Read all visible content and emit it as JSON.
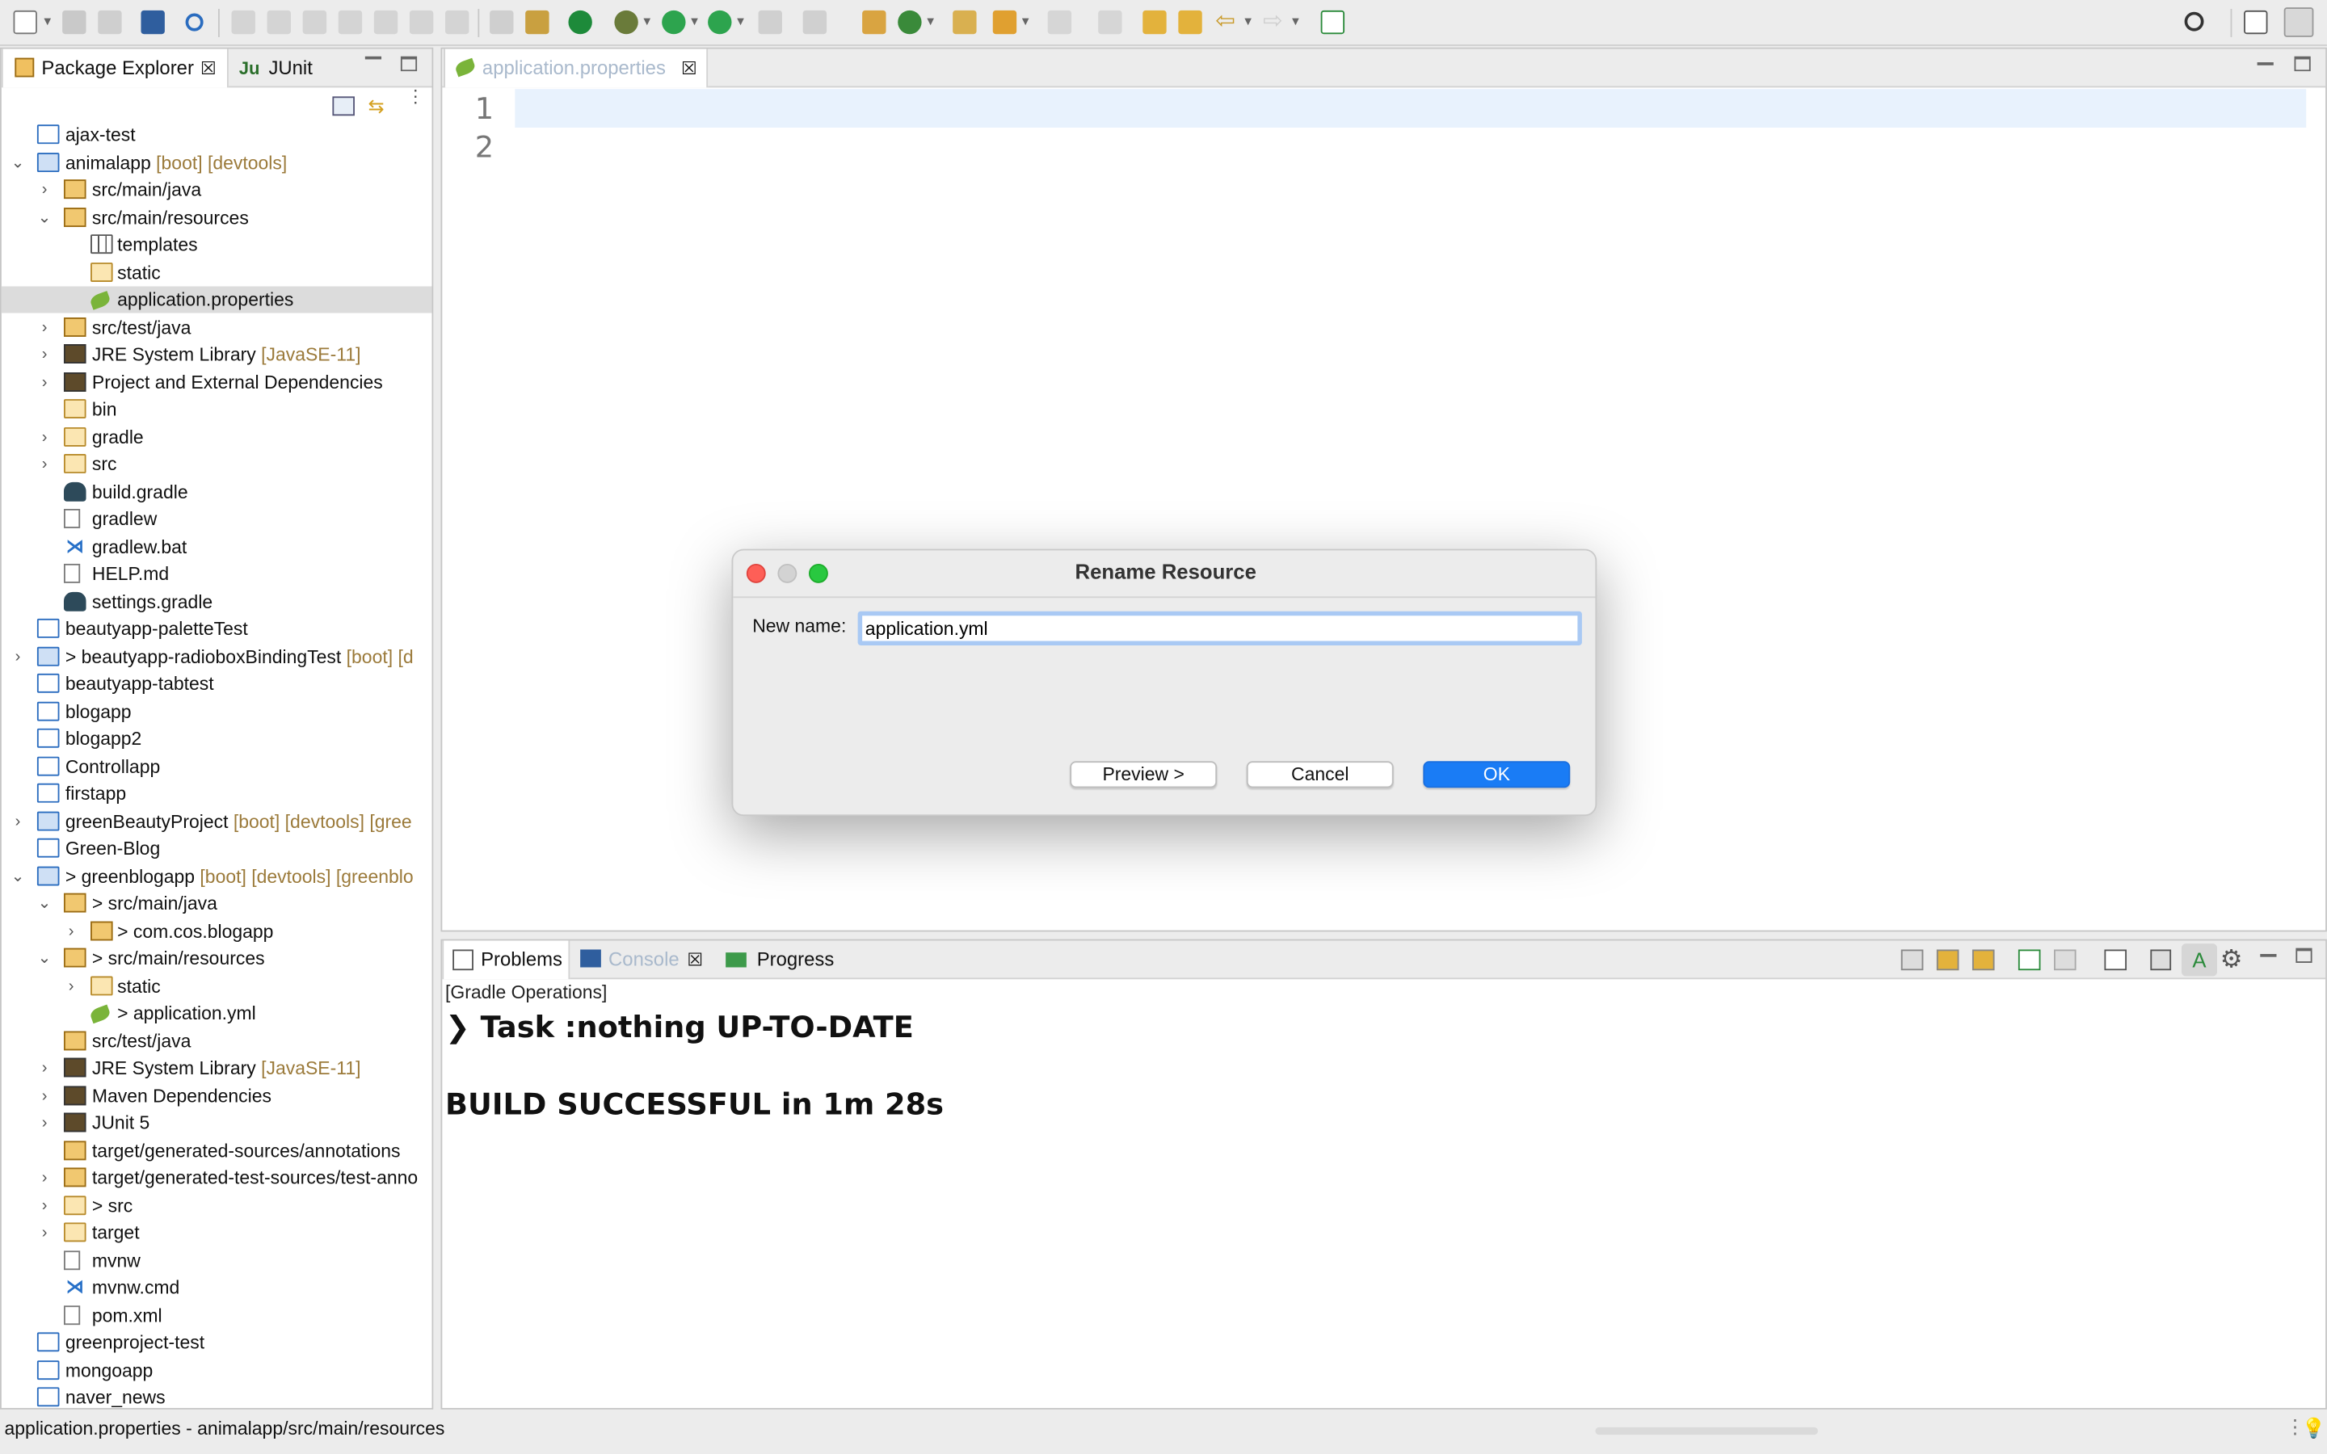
{
  "left_tabs": {
    "package_explorer": "Package Explorer",
    "junit": "JUnit"
  },
  "editor": {
    "tab_label": "application.properties",
    "line_numbers": [
      "1",
      "2"
    ]
  },
  "tree": [
    {
      "label": "ajax-test",
      "dec": ""
    },
    {
      "label": "animalapp",
      "dec": " [boot] [devtools]"
    },
    {
      "label": "src/main/java",
      "dec": ""
    },
    {
      "label": "src/main/resources",
      "dec": ""
    },
    {
      "label": "templates",
      "dec": ""
    },
    {
      "label": "static",
      "dec": ""
    },
    {
      "label": "application.properties",
      "dec": ""
    },
    {
      "label": "src/test/java",
      "dec": ""
    },
    {
      "label": "JRE System Library",
      "dec": " [JavaSE-11]"
    },
    {
      "label": "Project and External Dependencies",
      "dec": ""
    },
    {
      "label": "bin",
      "dec": ""
    },
    {
      "label": "gradle",
      "dec": ""
    },
    {
      "label": "src",
      "dec": ""
    },
    {
      "label": "build.gradle",
      "dec": ""
    },
    {
      "label": "gradlew",
      "dec": ""
    },
    {
      "label": "gradlew.bat",
      "dec": ""
    },
    {
      "label": "HELP.md",
      "dec": ""
    },
    {
      "label": "settings.gradle",
      "dec": ""
    },
    {
      "label": "beautyapp-paletteTest",
      "dec": ""
    },
    {
      "label": "> beautyapp-radioboxBindingTest",
      "dec": " [boot] [d"
    },
    {
      "label": "beautyapp-tabtest",
      "dec": ""
    },
    {
      "label": "blogapp",
      "dec": ""
    },
    {
      "label": "blogapp2",
      "dec": ""
    },
    {
      "label": "Controllapp",
      "dec": ""
    },
    {
      "label": "firstapp",
      "dec": ""
    },
    {
      "label": "greenBeautyProject",
      "dec": " [boot] [devtools] [gree"
    },
    {
      "label": "Green-Blog",
      "dec": ""
    },
    {
      "label": "> greenblogapp",
      "dec": " [boot] [devtools] [greenblo"
    },
    {
      "label": "> src/main/java",
      "dec": ""
    },
    {
      "label": "> com.cos.blogapp",
      "dec": ""
    },
    {
      "label": "> src/main/resources",
      "dec": ""
    },
    {
      "label": "static",
      "dec": ""
    },
    {
      "label": "> application.yml",
      "dec": ""
    },
    {
      "label": "src/test/java",
      "dec": ""
    },
    {
      "label": "JRE System Library",
      "dec": " [JavaSE-11]"
    },
    {
      "label": "Maven Dependencies",
      "dec": ""
    },
    {
      "label": "JUnit 5",
      "dec": ""
    },
    {
      "label": "target/generated-sources/annotations",
      "dec": ""
    },
    {
      "label": "target/generated-test-sources/test-anno",
      "dec": ""
    },
    {
      "label": "> src",
      "dec": ""
    },
    {
      "label": "target",
      "dec": ""
    },
    {
      "label": "mvnw",
      "dec": ""
    },
    {
      "label": "mvnw.cmd",
      "dec": ""
    },
    {
      "label": "pom.xml",
      "dec": ""
    },
    {
      "label": "greenproject-test",
      "dec": ""
    },
    {
      "label": "mongoapp",
      "dec": ""
    },
    {
      "label": "naver_news",
      "dec": ""
    }
  ],
  "bottom_tabs": {
    "problems": "Problems",
    "console": "Console",
    "progress": "Progress"
  },
  "console": {
    "header": "[Gradle Operations]",
    "task_line": "Task :nothing UP-TO-DATE",
    "build_line": "BUILD SUCCESSFUL in 1m 28s"
  },
  "dialog": {
    "title": "Rename Resource",
    "new_name_label": "New name:",
    "new_name_value": "application.yml",
    "preview_button": "Preview >",
    "cancel_button": "Cancel",
    "ok_button": "OK"
  },
  "status_bar": {
    "text": "application.properties - animalapp/src/main/resources"
  }
}
